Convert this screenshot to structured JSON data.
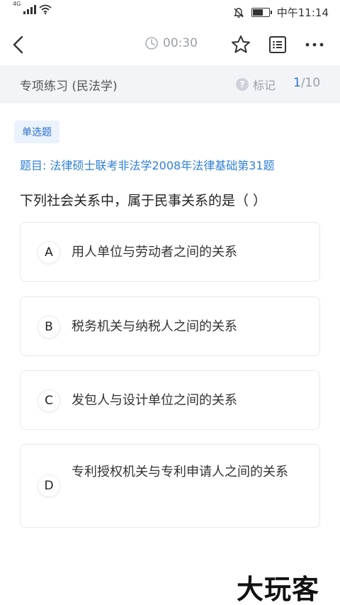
{
  "status_bar": {
    "network": "4G",
    "time": "中午11:14"
  },
  "nav": {
    "timer": "00:30",
    "icons": {
      "back": "chevron-left-icon",
      "clock": "clock-icon",
      "favorite": "star-outline-icon",
      "answer_sheet": "list-icon",
      "more": "more-dots-icon"
    }
  },
  "sub_header": {
    "title": "专项练习 (民法学)",
    "mark_label": "标记",
    "progress_current": "1",
    "progress_total": "/10"
  },
  "question": {
    "type_tag": "单选题",
    "source": "题目: 法律硕士联考非法学2008年法律基础第31题",
    "stem": "下列社会关系中，属于民事关系的是（  ）",
    "options": [
      {
        "letter": "A",
        "text": "用人单位与劳动者之间的关系"
      },
      {
        "letter": "B",
        "text": "税务机关与纳税人之间的关系"
      },
      {
        "letter": "C",
        "text": "发包人与设计单位之间的关系"
      },
      {
        "letter": "D",
        "text": "专利授权机关与专利申请人之间的关系"
      }
    ]
  },
  "watermark": "大玩客",
  "colors": {
    "accent": "#2f6fcf",
    "tag_bg": "#eaf2fd",
    "header_bg": "#f2f4f7",
    "muted": "#9aa0a8"
  }
}
